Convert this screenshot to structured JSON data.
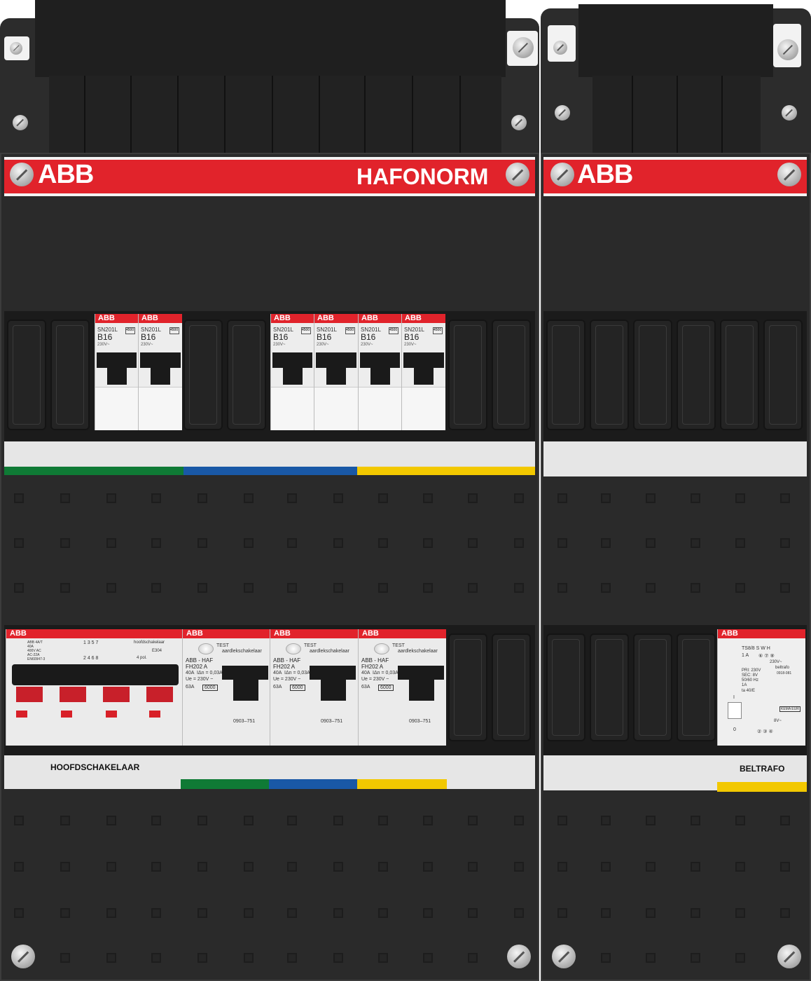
{
  "brand": {
    "logo": "ABB",
    "product": "HAFONORM"
  },
  "main_panel": {
    "row1_breakers": [
      {
        "logo": "ABB",
        "model": "SN201L",
        "rating": "B16",
        "voltage": "230V~",
        "code": "4500"
      },
      {
        "logo": "ABB",
        "model": "SN201L",
        "rating": "B16",
        "voltage": "230V~",
        "code": "4500"
      },
      {
        "logo": "ABB",
        "model": "SN201L",
        "rating": "B16",
        "voltage": "230V~",
        "code": "4500"
      },
      {
        "logo": "ABB",
        "model": "SN201L",
        "rating": "B16",
        "voltage": "230V~",
        "code": "4500"
      },
      {
        "logo": "ABB",
        "model": "SN201L",
        "rating": "B16",
        "voltage": "230V~",
        "code": "4500"
      },
      {
        "logo": "ABB",
        "model": "SN201L",
        "rating": "B16",
        "voltage": "230V~",
        "code": "4500"
      }
    ],
    "main_switch": {
      "logo": "ABB",
      "spec": [
        "ABB 4A/T",
        "40A",
        "400V AC",
        "AC-22A",
        "EN60947-3"
      ],
      "terminals_top": "1 3 5 7",
      "terminals_bottom": "2 4 6 8",
      "name": "hoofdschakelaar",
      "code": "E304",
      "poles": "4 pol.",
      "label": "HOOFDSCHAKELAAR"
    },
    "rcds": [
      {
        "logo": "ABB",
        "test": "TEST",
        "test_sub": "aardlekschakelaar",
        "brand": "ABB - HAF",
        "model": "FH202  A",
        "rating": "40A",
        "sensitivity": "IΔn = 0,03A",
        "voltage": "Ue = 230V ~",
        "icn": "63A",
        "code": "6000",
        "article": "0903–751"
      },
      {
        "logo": "ABB",
        "test": "TEST",
        "test_sub": "aardlekschakelaar",
        "brand": "ABB - HAF",
        "model": "FH202  A",
        "rating": "40A",
        "sensitivity": "IΔn = 0,03A",
        "voltage": "Ue = 230V ~",
        "icn": "63A",
        "code": "6000",
        "article": "0903–751"
      },
      {
        "logo": "ABB",
        "test": "TEST",
        "test_sub": "aardlekschakelaar",
        "brand": "ABB - HAF",
        "model": "FH202  A",
        "rating": "40A",
        "sensitivity": "IΔn = 0,03A",
        "voltage": "Ue = 230V ~",
        "icn": "63A",
        "code": "6000",
        "article": "0903–751"
      }
    ]
  },
  "side_panel": {
    "transformer": {
      "logo": "ABB",
      "model": "TS8/8  S W H",
      "current": "1 A",
      "terminals_top": "⑥  ⑦  ⑧",
      "sec_voltage": "230V~",
      "name": "beltrafo",
      "pri": "PRI: 230V",
      "sec": "SEC: 8V",
      "freq": "50/60 Hz",
      "amp": "1A",
      "ta": "ta 40/E",
      "article": "0918-081",
      "switch_on": "I",
      "switch_off": "0",
      "terminals_bottom": "②  ③  ④",
      "out_voltage": "8V~",
      "kema": "KEMA EUR",
      "label": "BELTRAFO"
    }
  },
  "colors": {
    "red": "#e1232b",
    "green": "#0f7a35",
    "blue": "#1958a6",
    "yellow": "#f2c800",
    "dark": "#2a2a2a"
  }
}
